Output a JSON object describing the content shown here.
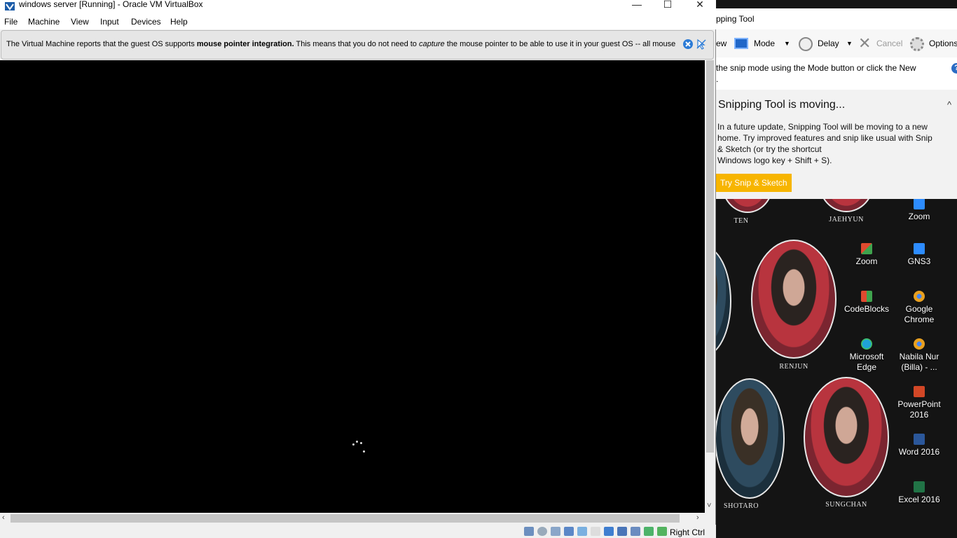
{
  "vbox": {
    "title": "windows server [Running] - Oracle VM VirtualBox",
    "window_controls": {
      "minimize": "—",
      "maximize": "☐",
      "close": "✕"
    },
    "menu": [
      "File",
      "Machine",
      "View",
      "Input",
      "Devices",
      "Help"
    ],
    "notice": {
      "part1": "The Virtual Machine reports that the guest OS supports ",
      "bold": "mouse pointer integration.",
      "part2": " This means that you do not need to ",
      "italic": "capture",
      "part3": " the mouse pointer to be able to use it in your guest OS -- all mouse"
    },
    "host_key": "Right Ctrl"
  },
  "snipping_tool": {
    "title": "pping Tool",
    "toolbar": {
      "new_label": "ew",
      "mode_label": "Mode",
      "delay_label": "Delay",
      "cancel_label": "Cancel",
      "options_label": "Options"
    },
    "hint_line1": "the snip mode using the Mode button or click the New",
    "hint_line2": ".",
    "help": "?",
    "panel": {
      "heading": "Snipping Tool is moving...",
      "chevron": "^",
      "body_line1": "In a future update, Snipping Tool will be moving to a new",
      "body_line2": "home. Try improved features and snip like usual with Snip",
      "body_line3": "& Sketch (or try the shortcut",
      "body_line4": "Windows logo key + Shift + S).",
      "button": "Try Snip & Sketch"
    }
  },
  "desktop": {
    "portrait_names": [
      "TEN",
      "JAEHYUN",
      "RENJUN",
      "SHOTARO",
      "SUNGCHAN"
    ],
    "icons": [
      {
        "label1": "Zoom",
        "label2": "",
        "color": "#2d8cff"
      },
      {
        "label1": "Zoom",
        "label2": "",
        "color": "#e04a2f"
      },
      {
        "label1": "GNS3",
        "label2": "",
        "color": "#2d8cff"
      },
      {
        "label1": "CodeBlocks",
        "label2": "",
        "color": "#3fa34d"
      },
      {
        "label1": "Google",
        "label2": "Chrome",
        "color": "#e8a020"
      },
      {
        "label1": "Microsoft",
        "label2": "Edge",
        "color": "#1fa3d8"
      },
      {
        "label1": "Nabila Nur",
        "label2": "(Billa) - ...",
        "color": "#e8a020"
      },
      {
        "label1": "PowerPoint",
        "label2": "2016",
        "color": "#d24726"
      },
      {
        "label1": "Word 2016",
        "label2": "",
        "color": "#2b579a"
      },
      {
        "label1": "Excel 2016",
        "label2": "",
        "color": "#217346"
      }
    ]
  }
}
